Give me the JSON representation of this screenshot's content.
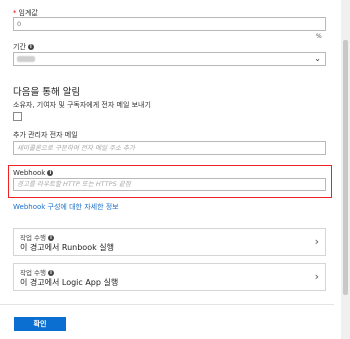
{
  "threshold": {
    "label": "임계값",
    "value": "0",
    "unit": "%"
  },
  "period": {
    "label": "기간",
    "value": ""
  },
  "notify": {
    "title": "다음을 통해 알림",
    "email_owner_label": "소유자, 기여자 및 구독자에게 전자 메일 보내기",
    "email_owner_checked": false,
    "additional_admin_label": "추가 관리자 전자 메일",
    "additional_admin_placeholder": "세미콜론으로 구분하여 전자 메일 주소 추가",
    "webhook_label": "Webhook",
    "webhook_placeholder": "경고를 라우트할 HTTP 또는 HTTPS 끝점",
    "webhook_link": "Webhook 구성에 대한 자세한 정보"
  },
  "actions": [
    {
      "kind": "작업 수행",
      "label": "이 경고에서 Runbook 실행"
    },
    {
      "kind": "작업 수행",
      "label": "이 경고에서 Logic App 실행"
    }
  ],
  "ok_button": "확인",
  "colors": {
    "accent": "#0a6fd0",
    "link": "#1a6fc9",
    "highlight": "#e22222",
    "required": "#dd0000"
  }
}
